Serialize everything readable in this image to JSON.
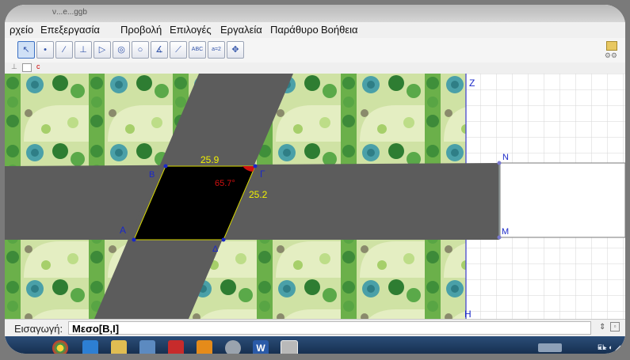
{
  "window": {
    "title": "ν...e...ggb"
  },
  "menu": [
    "ρχείο",
    "Επεξεργασία",
    "Προβολή",
    "Επιλογές",
    "Εργαλεία",
    "Παράθυρο",
    "Βοήθεια"
  ],
  "toolbar": {
    "abc_label": "ABC",
    "slider_label": "a=2"
  },
  "stylebar": {
    "label": "c"
  },
  "graphics": {
    "points": {
      "B": "B",
      "Gamma": "Γ",
      "A": "A",
      "Delta": "Δ",
      "N": "N",
      "M": "M",
      "Z": "Z",
      "H": "H"
    },
    "side_top": "25.9",
    "side_right": "25.2",
    "angle": "65.7°",
    "colors": {
      "road": "#5c5c5c",
      "parallelogram": "#000000",
      "angle": "#d01010",
      "value_label": "#f2f200",
      "point_label": "#1a28c8"
    }
  },
  "input": {
    "label": "Εισαγωγή:",
    "value": "Μεσο[B,I]"
  },
  "taskbar": {
    "lang": "EL"
  }
}
